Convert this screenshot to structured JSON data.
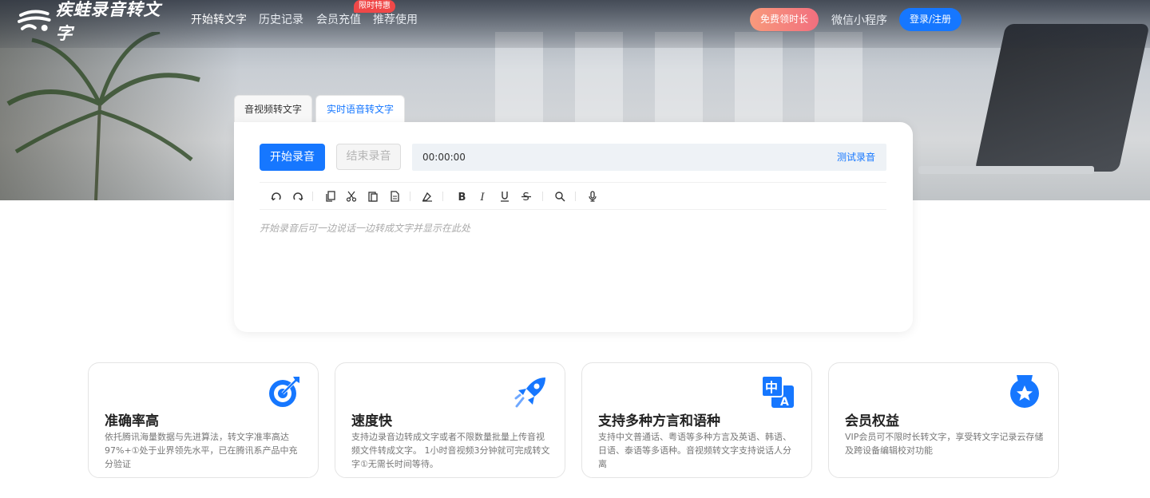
{
  "nav": {
    "brand": "疾蛙录音转文字",
    "links": [
      "开始转文字",
      "历史记录",
      "会员充值",
      "推荐使用"
    ],
    "promo_badge": "限时特惠",
    "free_button": "免费领时长",
    "mini_program": "微信小程序",
    "login_button": "登录/注册"
  },
  "tabs": [
    "音视频转文字",
    "实时语音转文字"
  ],
  "panel": {
    "start_button": "开始录音",
    "stop_button": "结束录音",
    "timer": "00:00:00",
    "test_link": "测试录音",
    "placeholder": "开始录音后可一边说话一边转成文字并显示在此处",
    "toolbar_icons": [
      "undo-icon",
      "redo-icon",
      "copy-icon",
      "cut-icon",
      "paste-icon",
      "paste-text-icon",
      "clear-format-icon",
      "bold-icon",
      "italic-icon",
      "underline-icon",
      "strikethrough-icon",
      "search-icon",
      "microphone-icon"
    ]
  },
  "features": [
    {
      "icon": "target-icon",
      "title": "准确率高",
      "desc": "依托腾讯海量数据与先进算法，转文字准率高达97%+①处于业界领先水平，已在腾讯系产品中充分验证"
    },
    {
      "icon": "rocket-icon",
      "title": "速度快",
      "desc": "支持边录音边转成文字或者不限数量批量上传音视频文件转成文字。 1小时音视频3分钟就可完成转文字①无需长时间等待。"
    },
    {
      "icon": "translate-icon",
      "title": "支持多种方言和语种",
      "desc": "支持中文普通话、粤语等多种方言及英语、韩语、日语、泰语等多语种。音视频转文字支持说话人分离"
    },
    {
      "icon": "medal-icon",
      "title": "会员权益",
      "desc": "VIP会员可不限时长转文字，享受转文字记录云存储及跨设备编辑校对功能"
    }
  ],
  "colors": {
    "primary": "#1677ff",
    "promo": "#f04848"
  }
}
